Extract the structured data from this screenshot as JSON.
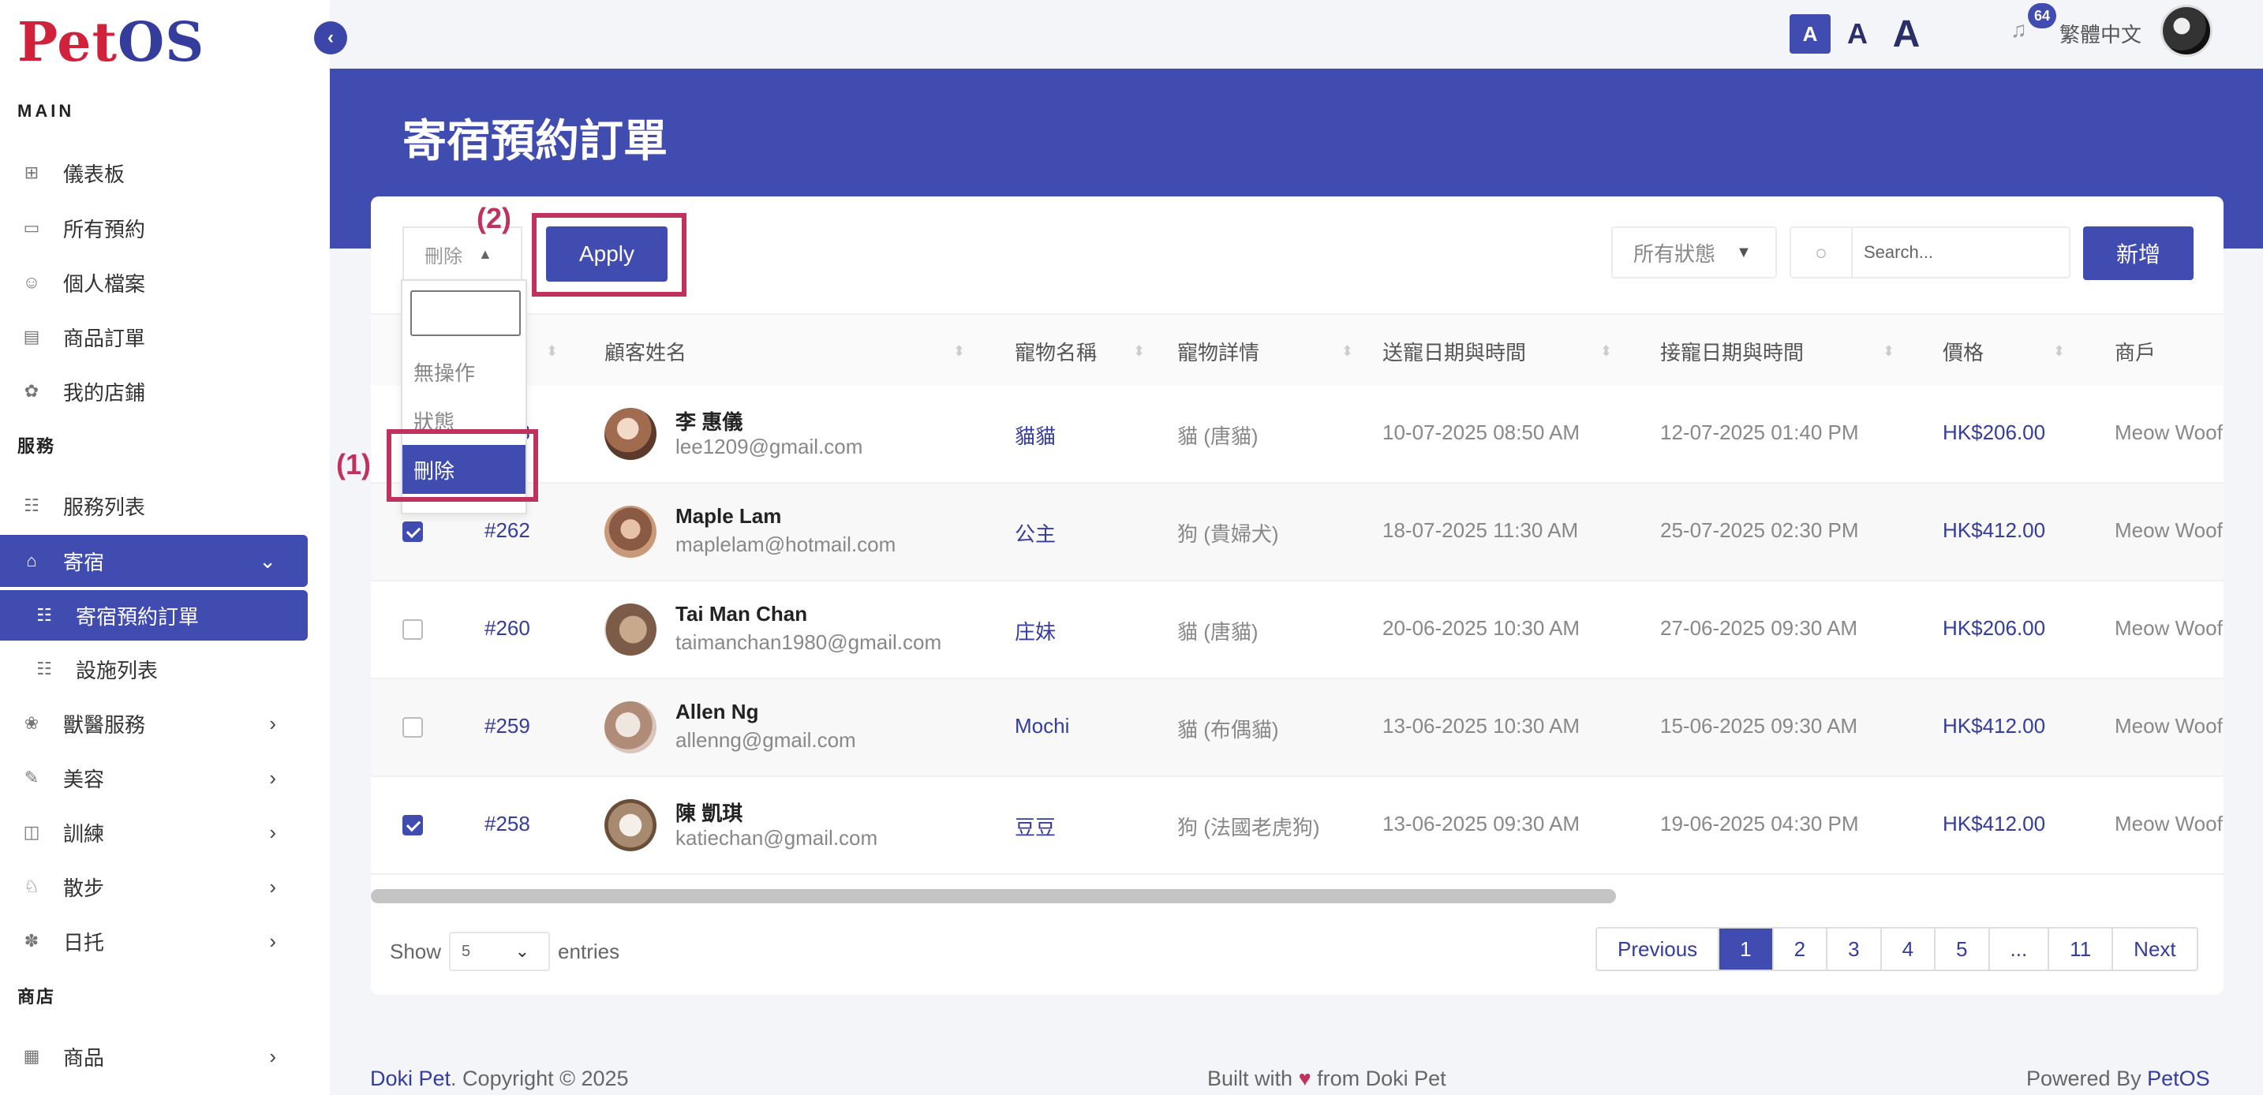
{
  "app": {
    "logo_part1": "Pet",
    "logo_part2": "OS"
  },
  "sidebar": {
    "section_main": "MAIN",
    "section_services": "服務",
    "section_shop": "商店",
    "main_items": [
      {
        "label": "儀表板",
        "icon": "grid-icon"
      },
      {
        "label": "所有預約",
        "icon": "calendar-icon"
      },
      {
        "label": "個人檔案",
        "icon": "user-icon"
      },
      {
        "label": "商品訂單",
        "icon": "clipboard-icon"
      },
      {
        "label": "我的店鋪",
        "icon": "store-icon"
      }
    ],
    "service_items": [
      {
        "label": "服務列表",
        "icon": "list-icon"
      },
      {
        "label": "寄宿",
        "icon": "home-icon",
        "expanded": true
      },
      {
        "label": "寄宿預約訂單",
        "icon": "list-icon",
        "sub": true,
        "active": true
      },
      {
        "label": "設施列表",
        "icon": "list-icon",
        "sub": true
      },
      {
        "label": "獸醫服務",
        "icon": "paw-icon"
      },
      {
        "label": "美容",
        "icon": "brush-icon"
      },
      {
        "label": "訓練",
        "icon": "whistle-icon"
      },
      {
        "label": "散步",
        "icon": "dog-icon"
      },
      {
        "label": "日托",
        "icon": "pawprint-icon"
      }
    ],
    "shop_items": [
      {
        "label": "商品",
        "icon": "shop-icon"
      }
    ]
  },
  "topbar": {
    "font_small": "A",
    "font_mid": "A",
    "font_large": "A",
    "notification_count": "64",
    "language": "繁體中文"
  },
  "page": {
    "title": "寄宿預約訂單"
  },
  "toolbar": {
    "bulk_action_value": "刪除",
    "apply_label": "Apply",
    "status_filter": "所有狀態",
    "search_placeholder": "Search...",
    "add_label": "新增"
  },
  "bulk_dropdown": {
    "options": [
      "無操作",
      "狀態",
      "刪除"
    ],
    "selected": "刪除"
  },
  "annotations": {
    "one": "(1)",
    "two": "(2)"
  },
  "table": {
    "headers": [
      "顧客姓名",
      "寵物名稱",
      "寵物詳情",
      "送寵日期與時間",
      "接寵日期與時間",
      "價格",
      "商戶"
    ],
    "rows": [
      {
        "checked": false,
        "id": "#263",
        "name": "李 惠儀",
        "email": "lee1209@gmail.com",
        "pet": "貓貓",
        "detail": "貓 (唐貓)",
        "drop": "10-07-2025 08:50 AM",
        "pick": "12-07-2025 01:40 PM",
        "price": "HK$206.00",
        "merchant": "Meow Woof"
      },
      {
        "checked": true,
        "id": "#262",
        "name": "Maple Lam",
        "email": "maplelam@hotmail.com",
        "pet": "公主",
        "detail": "狗 (貴婦犬)",
        "drop": "18-07-2025 11:30 AM",
        "pick": "25-07-2025 02:30 PM",
        "price": "HK$412.00",
        "merchant": "Meow Woof"
      },
      {
        "checked": false,
        "id": "#260",
        "name": "Tai Man Chan",
        "email": "taimanchan1980@gmail.com",
        "pet": "庄妹",
        "detail": "貓 (唐貓)",
        "drop": "20-06-2025 10:30 AM",
        "pick": "27-06-2025 09:30 AM",
        "price": "HK$206.00",
        "merchant": "Meow Woof"
      },
      {
        "checked": false,
        "id": "#259",
        "name": "Allen Ng",
        "email": "allenng@gmail.com",
        "pet": "Mochi",
        "detail": "貓 (布偶貓)",
        "drop": "13-06-2025 10:30 AM",
        "pick": "15-06-2025 09:30 AM",
        "price": "HK$412.00",
        "merchant": "Meow Woof"
      },
      {
        "checked": true,
        "id": "#258",
        "name": "陳 凱琪",
        "email": "katiechan@gmail.com",
        "pet": "豆豆",
        "detail": "狗 (法國老虎狗)",
        "drop": "13-06-2025 09:30 AM",
        "pick": "19-06-2025 04:30 PM",
        "price": "HK$412.00",
        "merchant": "Meow Woof"
      }
    ]
  },
  "footer_controls": {
    "show_label": "Show",
    "entries_value": "5",
    "entries_label": "entries",
    "pages": [
      "Previous",
      "1",
      "2",
      "3",
      "4",
      "5",
      "...",
      "11",
      "Next"
    ],
    "active_page": "1"
  },
  "footer": {
    "brand": "Doki Pet",
    "copyright": ". Copyright © 2025",
    "built_prefix": "Built with",
    "built_suffix": "from Doki Pet",
    "powered_prefix": "Powered By",
    "powered_brand": "PetOS"
  },
  "colors": {
    "primary": "#414cb0",
    "annotation": "#c0325e",
    "logo_red": "#d0223a"
  }
}
